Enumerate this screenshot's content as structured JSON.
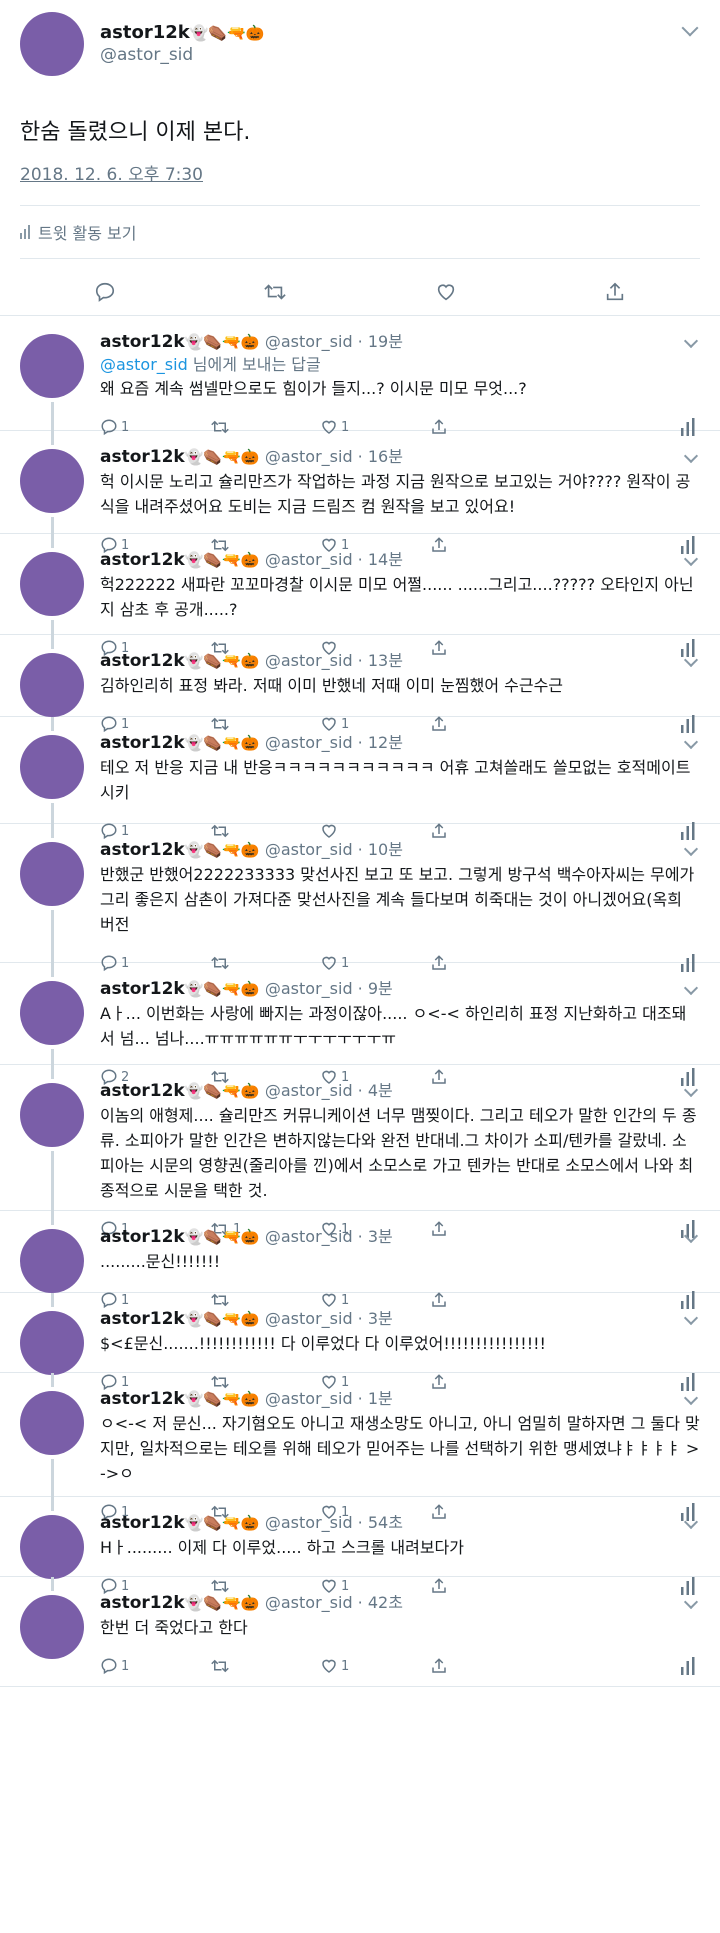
{
  "main": {
    "name": "astor12k",
    "emojis": "👻⚰️🔫🎃",
    "handle": "@astor_sid",
    "text": "한숨 돌렸으니 이제 본다.",
    "timestamp": "2018. 12. 6. 오후 7:30",
    "activity_label": "트윗 활동 보기"
  },
  "replies": [
    {
      "name": "astor12k",
      "emojis": "👻⚰️🔫🎃",
      "meta": "@astor_sid · 19분",
      "replying_mention": "@astor_sid",
      "replying_suffix": " 님에게 보내는 답글",
      "text": "왜 요즘 계속 썸넬만으로도 힘이가 들지...? 이시문 미모 무엇...?",
      "replies": "1",
      "retweets": "",
      "likes": "1"
    },
    {
      "name": "astor12k",
      "emojis": "👻⚰️🔫🎃",
      "meta": "@astor_sid · 16분",
      "text": "헉 이시문 노리고 슐리만즈가 작업하는 과정 지금 원작으로 보고있는 거야???? 원작이 공식을 내려주셨어요 도비는 지금 드림즈 컴 원작을 보고 있어요!",
      "replies": "1",
      "retweets": "",
      "likes": "1"
    },
    {
      "name": "astor12k",
      "emojis": "👻⚰️🔫🎃",
      "meta": "@astor_sid · 14분",
      "text": "헉222222 새파란 꼬꼬마경찰 이시문 미모 어쩔...... ......그리고....????? 오타인지 아닌지 삼초 후 공개.....?",
      "replies": "1",
      "retweets": "",
      "likes": ""
    },
    {
      "name": "astor12k",
      "emojis": "👻⚰️🔫🎃",
      "meta": "@astor_sid · 13분",
      "text": "김하인리히 표정 봐라. 저때 이미 반했네 저때 이미 눈찜했어 수근수근",
      "replies": "1",
      "retweets": "",
      "likes": "1"
    },
    {
      "name": "astor12k",
      "emojis": "👻⚰️🔫🎃",
      "meta": "@astor_sid · 12분",
      "text": "테오 저 반응 지금 내 반응ㅋㅋㅋㅋㅋㅋㅋㅋㅋㅋㅋ 어휴 고쳐쓸래도 쓸모없는 호적메이트 시키",
      "replies": "1",
      "retweets": "",
      "likes": ""
    },
    {
      "name": "astor12k",
      "emojis": "👻⚰️🔫🎃",
      "meta": "@astor_sid · 10분",
      "text": "반했군 반했어2222233333 맞선사진 보고 또 보고. 그렇게 방구석 백수아자씨는 무에가 그리 좋은지 삼촌이 가져다준 맞선사진을 계속 들다보며 히죽대는 것이 아니겠어요(옥희 버전",
      "replies": "1",
      "retweets": "",
      "likes": "1"
    },
    {
      "name": "astor12k",
      "emojis": "👻⚰️🔫🎃",
      "meta": "@astor_sid · 9분",
      "text": "Aㅏ... 이번화는 사랑에 빠지는 과정이잖아..... ㅇ<-< 하인리히 표정 지난화하고 대조돼서 넘... 넘나....ㅠㅠㅠㅠㅠㅠㅜㅜㅜㅜㅜㅜㅠ",
      "replies": "2",
      "retweets": "",
      "likes": "1"
    },
    {
      "name": "astor12k",
      "emojis": "👻⚰️🔫🎃",
      "meta": "@astor_sid · 4분",
      "text": "이놈의 애형제.... 슐리만즈 커뮤니케이션 너무 맴찢이다. 그리고 테오가 말한 인간의 두 종류. 소피아가 말한 인간은 변하지않는다와 완전 반대네.그 차이가 소피/텐카를 갈랐네. 소피아는 시문의 영향권(줄리아를 낀)에서 소모스로 가고 텐카는 반대로 소모스에서 나와 최종적으로 시문을 택한 것.",
      "replies": "1",
      "retweets": "1",
      "likes": "1"
    },
    {
      "name": "astor12k",
      "emojis": "👻⚰️🔫🎃",
      "meta": "@astor_sid · 3분",
      "text": ".........문신!!!!!!!",
      "replies": "1",
      "retweets": "",
      "likes": "1"
    },
    {
      "name": "astor12k",
      "emojis": "👻⚰️🔫🎃",
      "meta": "@astor_sid · 3분",
      "text": "$<£문신.......!!!!!!!!!!!! 다 이루었다 다 이루었어!!!!!!!!!!!!!!!!",
      "replies": "1",
      "retweets": "",
      "likes": "1"
    },
    {
      "name": "astor12k",
      "emojis": "👻⚰️🔫🎃",
      "meta": "@astor_sid · 1분",
      "text": "ㅇ<-< 저 문신... 자기혐오도 아니고 재생소망도 아니고, 아니 엄밀히 말하자면 그 둘다 맞지만, 일차적으로는 테오를 위해 테오가 믿어주는 나를 선택하기 위한 맹세였냐ㅑㅑㅑㅑ >->ㅇ",
      "replies": "1",
      "retweets": "",
      "likes": "1"
    },
    {
      "name": "astor12k",
      "emojis": "👻⚰️🔫🎃",
      "meta": "@astor_sid · 54초",
      "text": "Hㅏ......... 이제 다 이루었..... 하고 스크롤 내려보다가",
      "replies": "1",
      "retweets": "",
      "likes": "1"
    },
    {
      "name": "astor12k",
      "emojis": "👻⚰️🔫🎃",
      "meta": "@astor_sid · 42초",
      "text": "한번 더 죽었다고 한다",
      "replies": "1",
      "retweets": "",
      "likes": "1"
    }
  ]
}
